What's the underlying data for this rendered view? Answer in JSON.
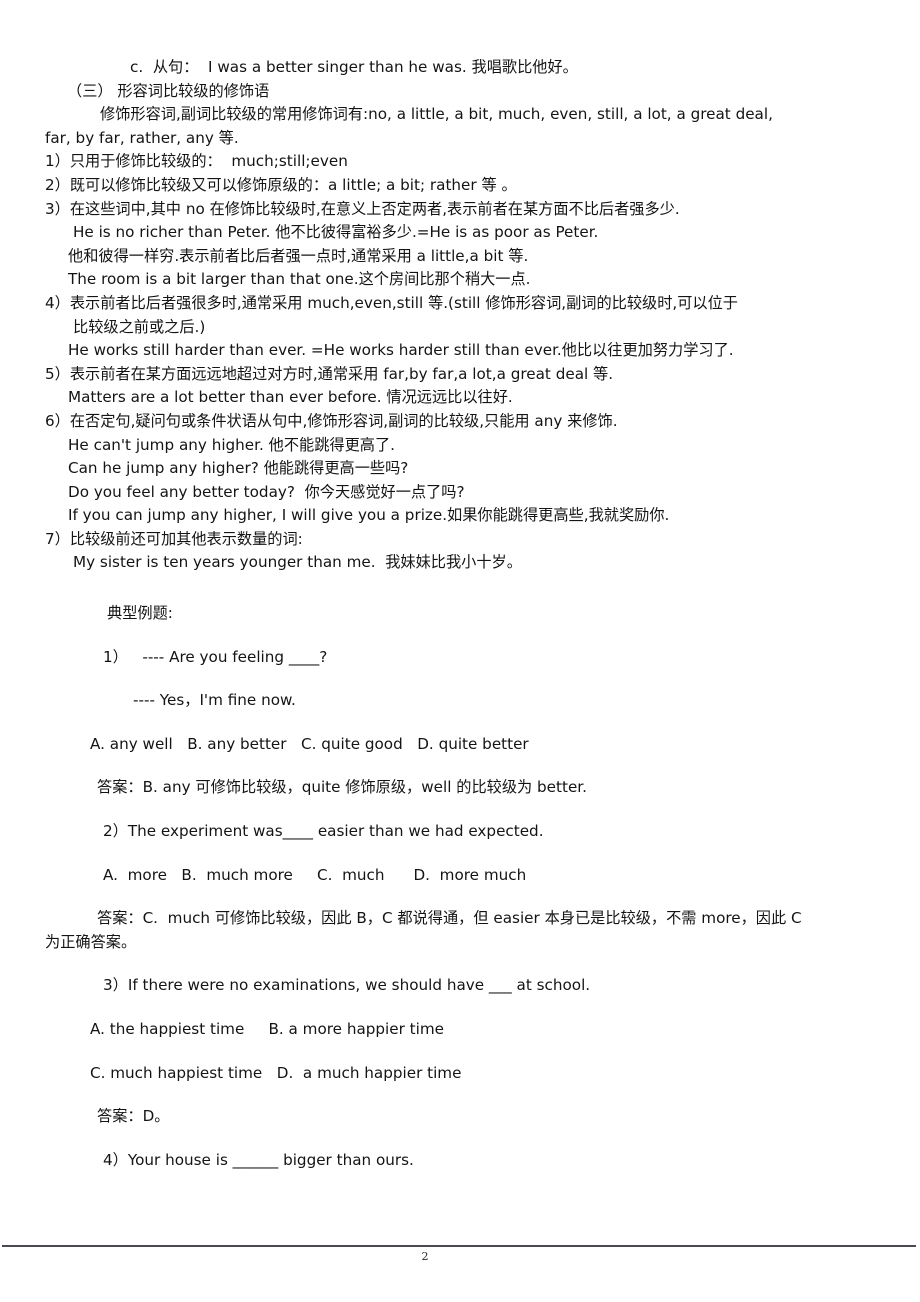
{
  "document": {
    "page_number": "2",
    "lines": [
      {
        "id": "l01",
        "indent": "i-c",
        "text": "c.  从句：  I was a better singer than he was. 我唱歌比他好。"
      },
      {
        "id": "l02",
        "indent": "i-head",
        "text": "（三） 形容词比较级的修饰语"
      },
      {
        "id": "l03",
        "indent": "i-par",
        "text": "修饰形容词,副词比较级的常用修饰词有:no, a little, a bit, much, even, still, a lot, a great deal,"
      },
      {
        "id": "l04",
        "indent": "i-0",
        "text": "far, by far, rather, any 等."
      },
      {
        "id": "l05",
        "indent": "i-0",
        "text": "1）只用于修饰比较级的：  much;still;even"
      },
      {
        "id": "l06",
        "indent": "i-0",
        "text": "2）既可以修饰比较级又可以修饰原级的：a little; a bit; rather 等 。"
      },
      {
        "id": "l07",
        "indent": "i-0",
        "text": "3）在这些词中,其中 no 在修饰比较级时,在意义上否定两者,表示前者在某方面不比后者强多少."
      },
      {
        "id": "l08",
        "indent": "i-ex",
        "text": "He is no richer than Peter. 他不比彼得富裕多少.=He is as poor as Peter."
      },
      {
        "id": "l09",
        "indent": "i-sub",
        "text": "他和彼得一样穷.表示前者比后者强一点时,通常采用 a little,a bit 等."
      },
      {
        "id": "l10",
        "indent": "i-sub",
        "text": "The room is a bit larger than that one.这个房间比那个稍大一点."
      },
      {
        "id": "l11",
        "indent": "i-0",
        "text": "4）表示前者比后者强很多时,通常采用 much,even,still 等.(still 修饰形容词,副词的比较级时,可以位于"
      },
      {
        "id": "l12",
        "indent": "i-ex",
        "text": "比较级之前或之后.)"
      },
      {
        "id": "l13",
        "indent": "i-sub",
        "text": "He works still harder than ever. =He works harder still than ever.他比以往更加努力学习了."
      },
      {
        "id": "l14",
        "indent": "i-0",
        "text": "5）表示前者在某方面远远地超过对方时,通常采用 far,by far,a lot,a great deal 等."
      },
      {
        "id": "l15",
        "indent": "i-sub",
        "text": "Matters are a lot better than ever before. 情况远远比以往好."
      },
      {
        "id": "l16",
        "indent": "i-0",
        "text": "6）在否定句,疑问句或条件状语从句中,修饰形容词,副词的比较级,只能用 any 来修饰."
      },
      {
        "id": "l17",
        "indent": "i-sub",
        "text": "He can't jump any higher. 他不能跳得更高了."
      },
      {
        "id": "l18",
        "indent": "i-sub",
        "text": "Can he jump any higher? 他能跳得更高一些吗?"
      },
      {
        "id": "l19",
        "indent": "i-sub",
        "text": "Do you feel any better today?  你今天感觉好一点了吗?"
      },
      {
        "id": "l20",
        "indent": "i-sub",
        "text": "If you can jump any higher, I will give you a prize.如果你能跳得更高些,我就奖励你."
      },
      {
        "id": "l21",
        "indent": "i-0",
        "text": "7）比较级前还可加其他表示数量的词:"
      },
      {
        "id": "l22",
        "indent": "i-ex",
        "text": "My sister is ten years younger than me.  我妹妹比我小十岁。"
      }
    ],
    "examples_heading": "典型例题:",
    "questions": [
      {
        "id": "q1",
        "stem": "1）   ---- Are you feeling ____?",
        "extra": "---- Yes，I'm fine now.",
        "options": "A. any well   B. any better   C. quite good   D. quite better",
        "answer": "答案：B. any 可修饰比较级，quite 修饰原级，well 的比较级为 better."
      },
      {
        "id": "q2",
        "stem": "2）The experiment was____ easier than we had expected.",
        "options": "A.  more   B.  much more     C.  much      D.  more much",
        "answer": "答案：C.  much 可修饰比较级，因此 B，C 都说得通，但 easier 本身已是比较级，不需 more，因此 C",
        "answer_cont": "为正确答案。"
      },
      {
        "id": "q3",
        "stem": "3）If there were no examinations, we should have ___ at school.",
        "options_a": "A. the happiest time     B. a more happier time",
        "options_b": "C. much happiest time   D.  a much happier time",
        "answer": "答案：D。"
      },
      {
        "id": "q4",
        "stem": "4）Your house is ______ bigger than ours."
      }
    ]
  }
}
